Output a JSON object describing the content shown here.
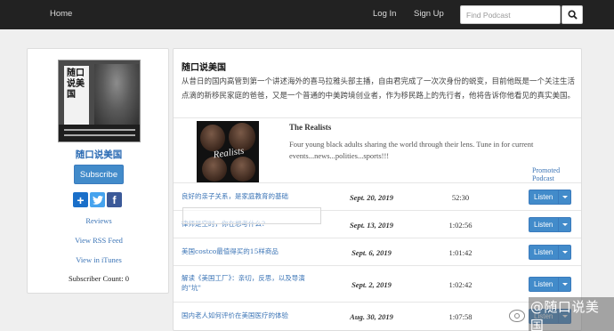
{
  "nav": {
    "home": "Home",
    "login": "Log In",
    "signup": "Sign Up",
    "search_placeholder": "Find Podcast"
  },
  "sidebar": {
    "cover_title": "随口说美国",
    "podcast_name": "随口说美国",
    "subscribe_label": "Subscribe",
    "share_icons": [
      "plus-share-icon",
      "twitter-icon",
      "facebook-icon"
    ],
    "links": [
      "Reviews",
      "View RSS Feed",
      "View in iTunes"
    ],
    "subscriber_count": "Subscriber Count: 0"
  },
  "main": {
    "title": "随口说美国",
    "description": "从昔日的国内高管到第一个讲述海外的喜马拉雅头部主播，自由君完成了一次次身份的蜕变，目前他既是一个关注生活点滴的新移民家庭的爸爸，又是一个普通的中美跨境创业者，作为移民路上的先行者，他将告诉你他看见的真实美国。",
    "promo": {
      "title": "The Realists",
      "logo_text": "Realists",
      "description": "Four young black adults sharing the world through their lens. Tune in for current events...news...polities...sports!!!",
      "label": "Promoted Podcast"
    },
    "listen_label": "Listen",
    "episodes": [
      {
        "title": "良好的亲子关系，是家庭教育的基础",
        "date": "Sept. 20, 2019",
        "duration": "52:30"
      },
      {
        "title": "律师是空时，你在想考什么?",
        "date": "Sept. 13, 2019",
        "duration": "1:02:56"
      },
      {
        "title": "美国costco最值得买的15样商品",
        "date": "Sept. 6, 2019",
        "duration": "1:01:42"
      },
      {
        "title": "解读《美国工厂》：亲切，反思，以及导演的\"坑\"",
        "date": "Sept. 2, 2019",
        "duration": "1:02:42"
      },
      {
        "title": "国内老人如何评价在美国医疗的体验",
        "date": "Aug. 30, 2019",
        "duration": "1:07:58"
      }
    ]
  },
  "watermark": "@随口说美国",
  "colors": {
    "navbar": "#222222",
    "accent": "#428bca",
    "link": "#3b74b6",
    "background": "#efefef"
  }
}
